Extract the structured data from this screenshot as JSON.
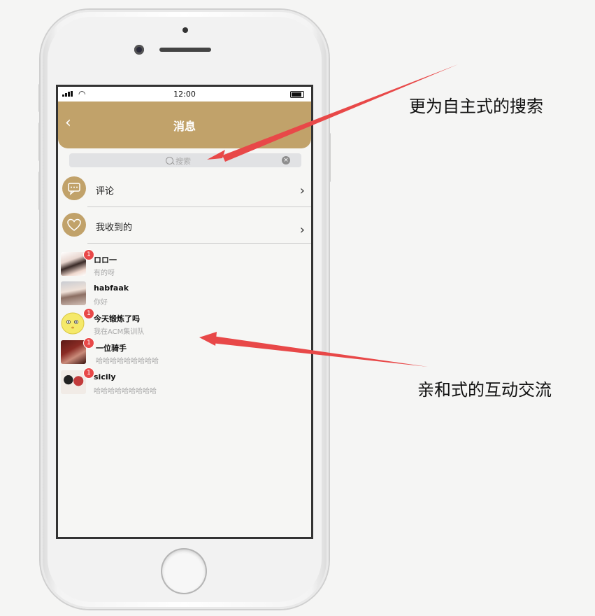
{
  "status_bar": {
    "time": "12:00"
  },
  "header": {
    "back_icon": "‹",
    "title": "消息"
  },
  "search": {
    "placeholder": "搜索"
  },
  "menu": [
    {
      "label": "评论",
      "icon": "chat-bubble-icon"
    },
    {
      "label": "我收到的",
      "icon": "heart-icon"
    }
  ],
  "chats": [
    {
      "name": "ロロ一",
      "message": "有的呀",
      "badge": "1"
    },
    {
      "name": "habfaak",
      "message": "你好",
      "badge": ""
    },
    {
      "name": "今天锻炼了吗",
      "message": "我在ACM集训队",
      "badge": "1"
    },
    {
      "name": "一位骑手",
      "message": "哈哈哈哈哈哈哈哈哈",
      "badge": "1"
    },
    {
      "name": "sicily",
      "message": "哈哈哈哈哈哈哈哈哈",
      "badge": "1"
    }
  ],
  "annotations": {
    "search_note": "更为自主式的搜索",
    "chat_note": "亲和式的互动交流"
  },
  "colors": {
    "accent": "#c1a26a",
    "badge": "#e84848",
    "arrow": "#e84848"
  }
}
